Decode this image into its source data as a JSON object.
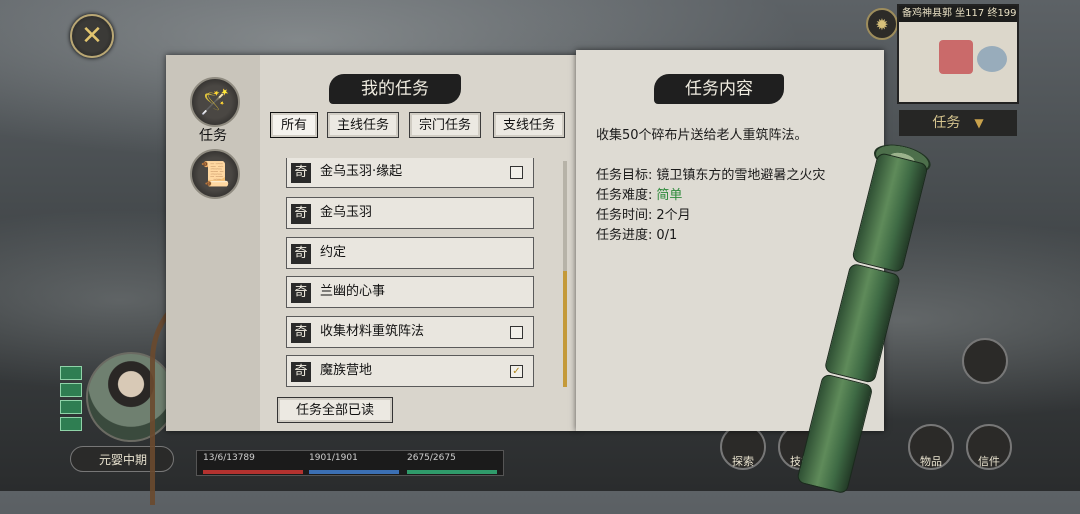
{
  "hud": {
    "close_icon": "✕",
    "gear_icon": "✹",
    "minimap_title": "备鸡神县郭 坐117 终199",
    "quest_tag": "任务",
    "quest_tag_arrow": "▼",
    "player_name": "元婴中期",
    "stats": {
      "hp": "13/6/13789",
      "mp": "1901/1901",
      "sp": "2675/2675"
    },
    "bottom_buttons": [
      "探索",
      "技能",
      "物品",
      "信件"
    ]
  },
  "panel": {
    "title": "我的任务",
    "side_tabs": [
      {
        "icon": "scroll-bundle",
        "label": "任务"
      },
      {
        "icon": "note-paper",
        "label": ""
      }
    ],
    "filters": [
      {
        "label": "所有",
        "active": true
      },
      {
        "label": "主线任务",
        "active": false
      },
      {
        "label": "宗门任务",
        "active": false
      },
      {
        "label": "支线任务",
        "active": false
      }
    ],
    "quests": [
      {
        "tag": "奇",
        "title": "金乌玉羽·缘起",
        "check": "empty"
      },
      {
        "tag": "奇",
        "title": "金乌玉羽",
        "check": "none"
      },
      {
        "tag": "奇",
        "title": "约定",
        "check": "none"
      },
      {
        "tag": "奇",
        "title": "兰幽的心事",
        "check": "none"
      },
      {
        "tag": "奇",
        "title": "收集材料重筑阵法",
        "check": "empty"
      },
      {
        "tag": "奇",
        "title": "魔族营地",
        "check": "checked"
      }
    ],
    "read_all": "任务全部已读"
  },
  "detail": {
    "title": "任务内容",
    "description": "收集50个碎布片送给老人重筑阵法。",
    "rows": [
      {
        "label": "任务目标:",
        "value": "镜卫镇东方的雪地避暑之火灾",
        "color": ""
      },
      {
        "label": "任务难度:",
        "value": "简单",
        "color": "green"
      },
      {
        "label": "任务时间:",
        "value": "2个月",
        "color": ""
      },
      {
        "label": "任务进度:",
        "value": "0/1",
        "color": ""
      }
    ]
  },
  "colors": {
    "accent": "#c49a3a",
    "ink": "#1f1f1f",
    "paper": "#d9d5cc",
    "easy_green": "#2f8b3c"
  }
}
